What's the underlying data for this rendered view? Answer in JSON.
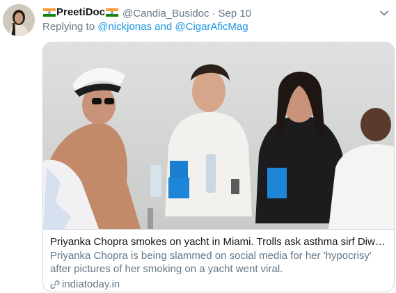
{
  "tweet": {
    "display_name": "PreetiDoc",
    "handle": "@Candia_Busidoc",
    "separator": "·",
    "date": "Sep 10",
    "reply_prefix": "Replying to",
    "reply_mention_1": "@nickjonas",
    "reply_and": "and",
    "reply_mention_2": "@CigarAficMag",
    "avatar_icon": "profile-avatar",
    "caret_icon": "chevron-down-icon",
    "flag_icon": "india-flag-icon"
  },
  "card": {
    "image_alt": "yacht photo",
    "title": "Priyanka Chopra smokes on yacht in Miami. Trolls ask asthma sirf Diwali pe hota hai?",
    "description": "Priyanka Chopra is being slammed on social media for her 'hypocrisy' after pictures of her smoking on a yacht went viral.",
    "domain": "indiatoday.in",
    "link_icon": "link-icon"
  },
  "colors": {
    "link": "#1b95e0",
    "secondary_text": "#657786",
    "border": "#ccd6dd",
    "flag_saffron": "#ff9933",
    "flag_green": "#138808"
  }
}
